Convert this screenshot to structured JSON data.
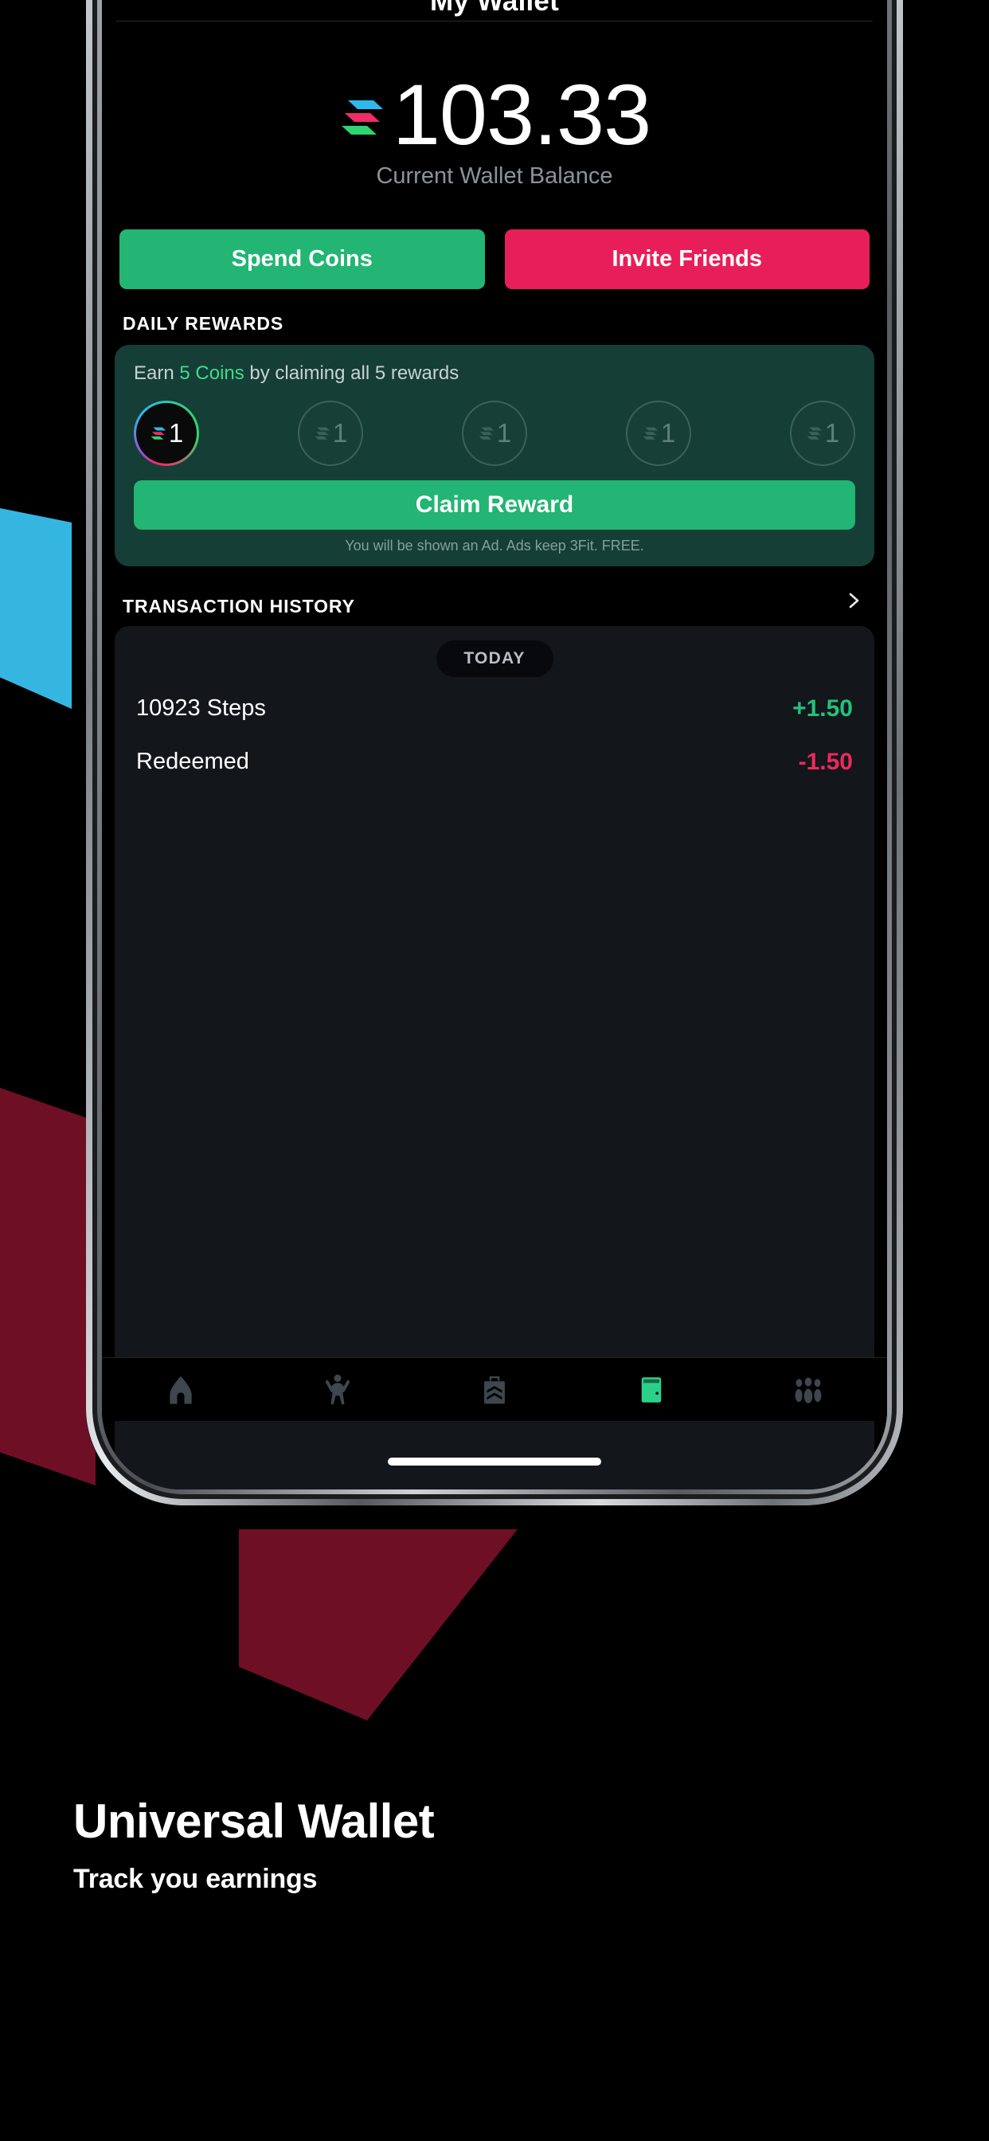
{
  "app": {
    "nav_title": "My Wallet",
    "balance": {
      "amount": "103.33",
      "caption": "Current Wallet Balance",
      "logo_icon": "coin-logo-icon"
    },
    "actions": {
      "spend_label": "Spend Coins",
      "invite_label": "Invite Friends",
      "spend_color": "#22b573",
      "invite_color": "#e81e5a"
    },
    "daily_rewards": {
      "section_title": "DAILY REWARDS",
      "earn_prefix": "Earn ",
      "earn_highlight": "5 Coins",
      "earn_suffix": " by claiming all 5 rewards",
      "highlight_color": "#3ddc8b",
      "card_color": "#153e37",
      "circles": [
        {
          "value": "1",
          "state": "active"
        },
        {
          "value": "1",
          "state": "inactive"
        },
        {
          "value": "1",
          "state": "inactive"
        },
        {
          "value": "1",
          "state": "inactive"
        },
        {
          "value": "1",
          "state": "inactive"
        }
      ],
      "claim_label": "Claim Reward",
      "claim_note": "You will be shown an Ad. Ads keep 3Fit. FREE."
    },
    "transaction_history": {
      "section_title": "TRANSACTION HISTORY",
      "more_icon": "chevron-right-icon",
      "day_badge": "TODAY",
      "rows": [
        {
          "label": "10923 Steps",
          "amount": "+1.50",
          "sign": "pos"
        },
        {
          "label": "Redeemed",
          "amount": "-1.50",
          "sign": "neg"
        }
      ],
      "positive_color": "#22c27d",
      "negative_color": "#ec2a5f"
    },
    "tabbar": {
      "items": [
        {
          "icon": "home-icon",
          "active": false
        },
        {
          "icon": "activity-person-icon",
          "active": false
        },
        {
          "icon": "shopping-bag-icon",
          "active": false
        },
        {
          "icon": "wallet-icon",
          "active": true
        },
        {
          "icon": "community-people-icon",
          "active": false
        }
      ],
      "active_color": "#2bd18a",
      "inactive_color": "#3e464e"
    }
  },
  "caption": {
    "title": "Universal Wallet",
    "subtitle": "Track you earnings"
  }
}
